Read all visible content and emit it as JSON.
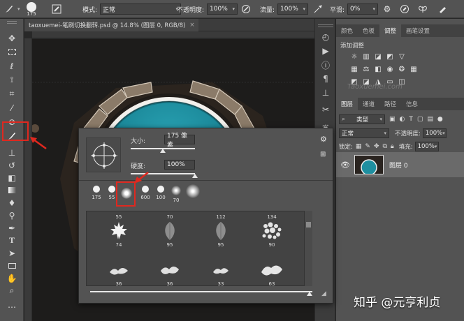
{
  "options_bar": {
    "brush_size": "175",
    "mode_label": "模式:",
    "mode_value": "正常",
    "opacity_label": "不透明度:",
    "opacity_value": "100%",
    "flow_label": "流量:",
    "flow_value": "100%",
    "smoothing_label": "平滑:",
    "smoothing_value": "0%"
  },
  "document": {
    "tab_title": "taoxuemei-笔刷切换翻转.psd @ 14.8% (图层 0, RGB/8)",
    "close_glyph": "×"
  },
  "right_panel": {
    "top_tabs": [
      "颜色",
      "色板",
      "调整",
      "画笔设置"
    ],
    "active_top_tab": 2,
    "adjustments_title": "添加调整",
    "watermark": "Taoxuemei.com",
    "layer_tabs": [
      "图层",
      "通道",
      "路径",
      "信息"
    ],
    "active_layer_tab": 0,
    "filter_kind": "类型",
    "blend_mode": "正常",
    "opacity_label": "不透明度:",
    "opacity_value": "100%",
    "lock_label": "锁定:",
    "fill_label": "填充:",
    "fill_value": "100%",
    "layer_name": "图层 0"
  },
  "brush_popup": {
    "size_label": "大小:",
    "size_value": "175 像素",
    "size_fraction": 0.5,
    "hardness_label": "硬度:",
    "hardness_value": "100%",
    "hardness_fraction": 1.0,
    "tips": [
      {
        "label": "175",
        "kind": "hard"
      },
      {
        "label": "55",
        "kind": "hard"
      },
      {
        "label": "",
        "kind": "soft",
        "selected": true
      },
      {
        "label": "600",
        "kind": "hard"
      },
      {
        "label": "100",
        "kind": "hard"
      },
      {
        "label": "70",
        "kind": "soft"
      },
      {
        "label": "",
        "kind": "soft"
      }
    ],
    "presets_row1": [
      {
        "top": "55",
        "num": "74",
        "shape": "maple-leaf"
      },
      {
        "top": "70",
        "num": "95",
        "shape": "leaf"
      },
      {
        "top": "112",
        "num": "95",
        "shape": "leaf"
      },
      {
        "top": "134",
        "num": "90",
        "shape": "scatter"
      }
    ],
    "presets_row2": [
      {
        "top": "",
        "num": "36",
        "shape": "grass"
      },
      {
        "top": "",
        "num": "36",
        "shape": "grass"
      },
      {
        "top": "",
        "num": "33",
        "shape": "grass"
      },
      {
        "top": "",
        "num": "63",
        "shape": "grass"
      }
    ]
  },
  "watermark_zhihu": "知乎 @元亨利贞",
  "colors": {
    "highlight": "#e0281f",
    "pool": "#1e8fa0",
    "panel": "#535353"
  }
}
